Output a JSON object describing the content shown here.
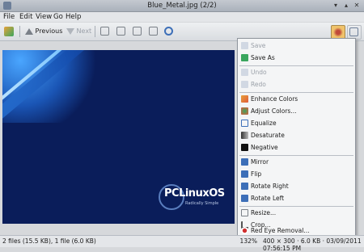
{
  "window": {
    "title": "Blue_Metal.jpg (2/2)"
  },
  "menubar": {
    "items": [
      "File",
      "Edit",
      "View",
      "Go",
      "Help"
    ]
  },
  "toolbar": {
    "previous": "Previous",
    "next": "Next"
  },
  "image": {
    "logo_text": "PCLinuxOS",
    "logo_tagline": "Radically Simple"
  },
  "dropdown": {
    "items": [
      {
        "label": "Save",
        "enabled": false,
        "icon": "save-icon"
      },
      {
        "label": "Save As",
        "enabled": true,
        "icon": "save-as-icon"
      },
      {
        "label": "Undo",
        "enabled": false,
        "icon": "undo-icon"
      },
      {
        "label": "Redo",
        "enabled": false,
        "icon": "redo-icon"
      },
      {
        "label": "Enhance Colors",
        "enabled": true,
        "icon": "enhance-colors-icon"
      },
      {
        "label": "Adjust Colors...",
        "enabled": true,
        "icon": "adjust-colors-icon"
      },
      {
        "label": "Equalize",
        "enabled": true,
        "icon": "equalize-icon"
      },
      {
        "label": "Desaturate",
        "enabled": true,
        "icon": "desaturate-icon"
      },
      {
        "label": "Negative",
        "enabled": true,
        "icon": "negative-icon"
      },
      {
        "label": "Mirror",
        "enabled": true,
        "icon": "mirror-icon"
      },
      {
        "label": "Flip",
        "enabled": true,
        "icon": "flip-icon"
      },
      {
        "label": "Rotate Right",
        "enabled": true,
        "icon": "rotate-right-icon"
      },
      {
        "label": "Rotate Left",
        "enabled": true,
        "icon": "rotate-left-icon"
      },
      {
        "label": "Resize...",
        "enabled": true,
        "icon": "resize-icon"
      },
      {
        "label": "Crop...",
        "enabled": true,
        "icon": "crop-icon"
      },
      {
        "label": "Red Eye Removal...",
        "enabled": true,
        "icon": "red-eye-icon"
      }
    ]
  },
  "status": {
    "files": "2 files (15.5 KB), 1 file (6.0 KB)",
    "zoom": "132%",
    "info": "400 × 300 · 6.0 KB · 03/09/2011 07:56:15 PM"
  },
  "colors": {
    "accent": "#3d6fb8",
    "image_bg": "#0a1d5a",
    "menu_bg": "#f4f5f6"
  }
}
